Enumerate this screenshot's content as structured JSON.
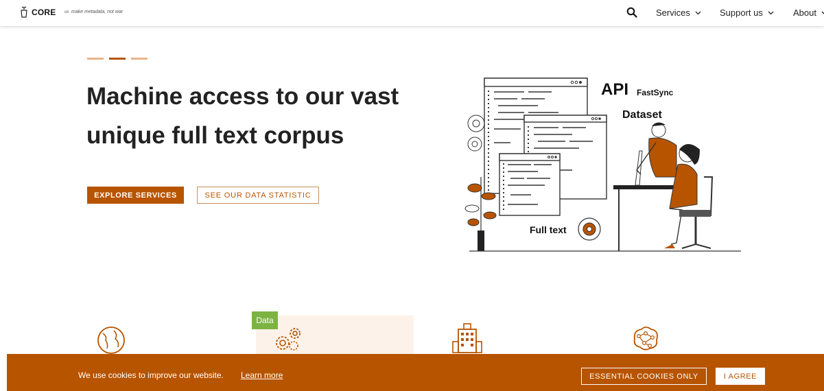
{
  "header": {
    "logo_text": "CORE",
    "lang": "uk",
    "tagline": "make metadata, not war",
    "nav": [
      {
        "label": "Services"
      },
      {
        "label": "Support us"
      },
      {
        "label": "About"
      }
    ]
  },
  "hero": {
    "title_line1": "Machine access to our vast",
    "title_line2": "unique full text corpus",
    "primary_button": "EXPLORE SERVICES",
    "secondary_button": "SEE OUR DATA STATISTIC",
    "illustration": {
      "api": "API",
      "fastsync": "FastSync",
      "dataset": "Dataset",
      "fulltext": "Full text"
    }
  },
  "features": {
    "badge": "Data",
    "icons": [
      "globe-icon",
      "gears-icon",
      "building-icon",
      "brain-network-icon"
    ]
  },
  "cookie": {
    "text": "We use cookies to improve our website.",
    "link": "Learn more",
    "essential": "ESSENTIAL COOKIES ONLY",
    "agree": "I AGREE"
  },
  "colors": {
    "accent": "#b75400",
    "badge": "#7cb342",
    "panel": "#fdf2e9"
  }
}
